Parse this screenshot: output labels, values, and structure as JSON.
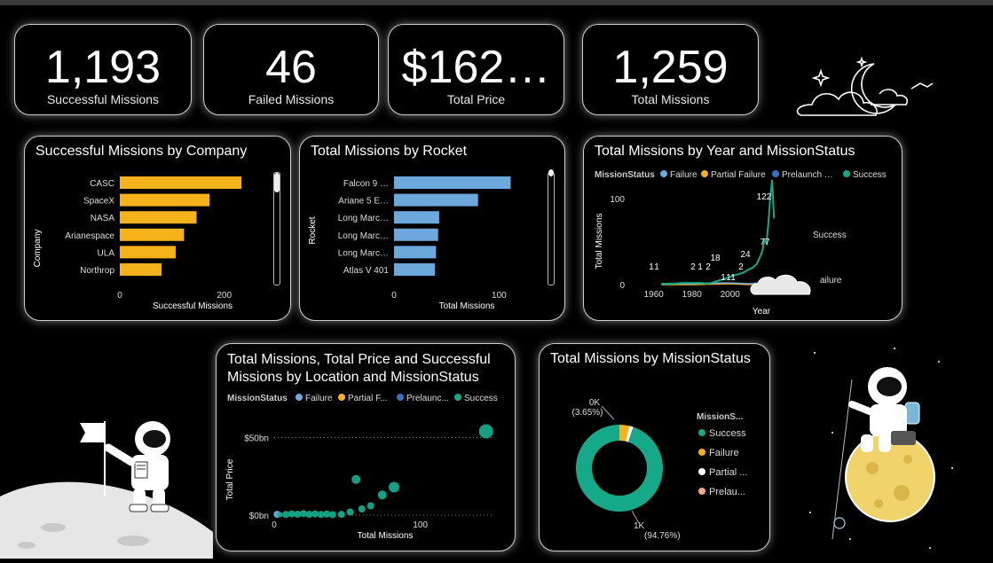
{
  "kpis": [
    {
      "value": "1,193",
      "label": "Successful Missions"
    },
    {
      "value": "46",
      "label": "Failed Missions"
    },
    {
      "value": "$162…",
      "label": "Total Price"
    },
    {
      "value": "1,259",
      "label": "Total Missions"
    }
  ],
  "colors": {
    "bar_company": "#f5b21b",
    "bar_rocket": "#6ca8dc",
    "failure": "#6ca8dc",
    "partial": "#f5b21b",
    "prelaunch": "#3a6fc0",
    "success": "#15a98a",
    "donut_partial": "#ffffff",
    "donut_prelaunch": "#f4a88c"
  },
  "chart_data": [
    {
      "type": "bar",
      "title": "Successful Missions by Company",
      "categories": [
        "CASC",
        "SpaceX",
        "NASA",
        "Arianespace",
        "ULA",
        "Northrop"
      ],
      "values": [
        233,
        172,
        147,
        123,
        107,
        80
      ],
      "xlabel": "Successful Missions",
      "ylabel": "Company",
      "xticks": [
        "0",
        "200"
      ],
      "xlim": [
        0,
        260
      ]
    },
    {
      "type": "bar",
      "title": "Total Missions by Rocket",
      "categories": [
        "Falcon 9 …",
        "Ariane 5 E…",
        "Long Marc…",
        "Long Marc…",
        "Long Marc…",
        "Atlas V 401"
      ],
      "values": [
        111,
        80,
        43,
        42,
        40,
        39
      ],
      "xlabel": "Total Missions",
      "ylabel": "Rocket",
      "xticks": [
        "0",
        "100"
      ],
      "xlim": [
        0,
        125
      ]
    },
    {
      "type": "line",
      "title": "Total Missions by Year and MissionStatus",
      "legend_title": "MissionStatus",
      "legend": [
        "Failure",
        "Partial Failure",
        "Prelaunch …",
        "Success"
      ],
      "xlabel": "Year",
      "ylabel": "Total Missions",
      "xticks": [
        "1960",
        "1980",
        "2000"
      ],
      "yticks": [
        "0",
        "100"
      ],
      "xlim": [
        1955,
        2035
      ],
      "ylim": [
        0,
        130
      ],
      "series": [
        {
          "name": "Success",
          "x": [
            1964,
            1966,
            1970,
            1975,
            1980,
            1985,
            1988,
            1990,
            1993,
            1996,
            1999,
            2001,
            2004,
            2007,
            2010,
            2012,
            2014,
            2016,
            2017,
            2018,
            2019,
            2020,
            2021,
            2022,
            2023
          ],
          "values": [
            1,
            1,
            1,
            2,
            2,
            2,
            1,
            2,
            4,
            6,
            8,
            10,
            12,
            14,
            18,
            20,
            24,
            34,
            40,
            52,
            48,
            70,
            100,
            122,
            77
          ]
        },
        {
          "name": "Failure",
          "x": [
            1964,
            1970,
            1980,
            1990,
            2000,
            2010,
            2020,
            2023
          ],
          "values": [
            0,
            1,
            1,
            2,
            2,
            1,
            3,
            2
          ]
        },
        {
          "name": "Partial Failure",
          "x": [
            1964,
            1980,
            2000,
            2010,
            2023
          ],
          "values": [
            0,
            0,
            1,
            0,
            1
          ]
        }
      ],
      "data_labels": [
        "1",
        "1",
        "2",
        "1",
        "2",
        "18",
        "1",
        "1",
        "1",
        "2",
        "24",
        "122",
        "77"
      ],
      "end_labels": [
        "Success",
        "ailure"
      ]
    },
    {
      "type": "scatter",
      "title": "Total Missions, Total Price and Successful Missions by Location and MissionStatus",
      "legend_title": "MissionStatus",
      "legend": [
        "Failure",
        "Partial F...",
        "Prelaunc...",
        "Success"
      ],
      "xlabel": "Total Missions",
      "ylabel": "Total Price",
      "xticks": [
        "0",
        "100"
      ],
      "yticks": [
        "$0bn",
        "$50bn"
      ],
      "xlim": [
        0,
        150
      ],
      "ylim": [
        0,
        60
      ],
      "points": [
        {
          "x": 2,
          "y": 0.5,
          "r": 4,
          "series": "Failure"
        },
        {
          "x": 4,
          "y": 0.3,
          "r": 3,
          "series": "Success"
        },
        {
          "x": 8,
          "y": 0.4,
          "r": 4,
          "series": "Success"
        },
        {
          "x": 12,
          "y": 0.8,
          "r": 4,
          "series": "Success"
        },
        {
          "x": 16,
          "y": 0.6,
          "r": 4,
          "series": "Success"
        },
        {
          "x": 20,
          "y": 1.0,
          "r": 4,
          "series": "Success"
        },
        {
          "x": 24,
          "y": 0.5,
          "r": 4,
          "series": "Success"
        },
        {
          "x": 28,
          "y": 0.8,
          "r": 4,
          "series": "Success"
        },
        {
          "x": 32,
          "y": 0.4,
          "r": 4,
          "series": "Success"
        },
        {
          "x": 36,
          "y": 0.7,
          "r": 4,
          "series": "Success"
        },
        {
          "x": 40,
          "y": 0.3,
          "r": 4,
          "series": "Success"
        },
        {
          "x": 46,
          "y": 0.5,
          "r": 4,
          "series": "Success"
        },
        {
          "x": 52,
          "y": 2.0,
          "r": 4,
          "series": "Success"
        },
        {
          "x": 56,
          "y": 23,
          "r": 5,
          "series": "Success"
        },
        {
          "x": 60,
          "y": 4,
          "r": 4,
          "series": "Success"
        },
        {
          "x": 66,
          "y": 6,
          "r": 4,
          "series": "Success"
        },
        {
          "x": 74,
          "y": 13,
          "r": 5,
          "series": "Success"
        },
        {
          "x": 82,
          "y": 18,
          "r": 6,
          "series": "Success"
        },
        {
          "x": 145,
          "y": 54,
          "r": 8,
          "series": "Success"
        }
      ]
    },
    {
      "type": "pie",
      "title": "Total Missions by MissionStatus",
      "legend_title": "MissionS...",
      "legend": [
        "Success",
        "Failure",
        "Partial ...",
        "Prelau..."
      ],
      "values": [
        1193,
        46,
        19,
        1
      ],
      "labels": [
        {
          "line1": "1K",
          "line2": "(94.76%)"
        },
        {
          "line1": "0K",
          "line2": "(3.65%)"
        }
      ]
    }
  ]
}
